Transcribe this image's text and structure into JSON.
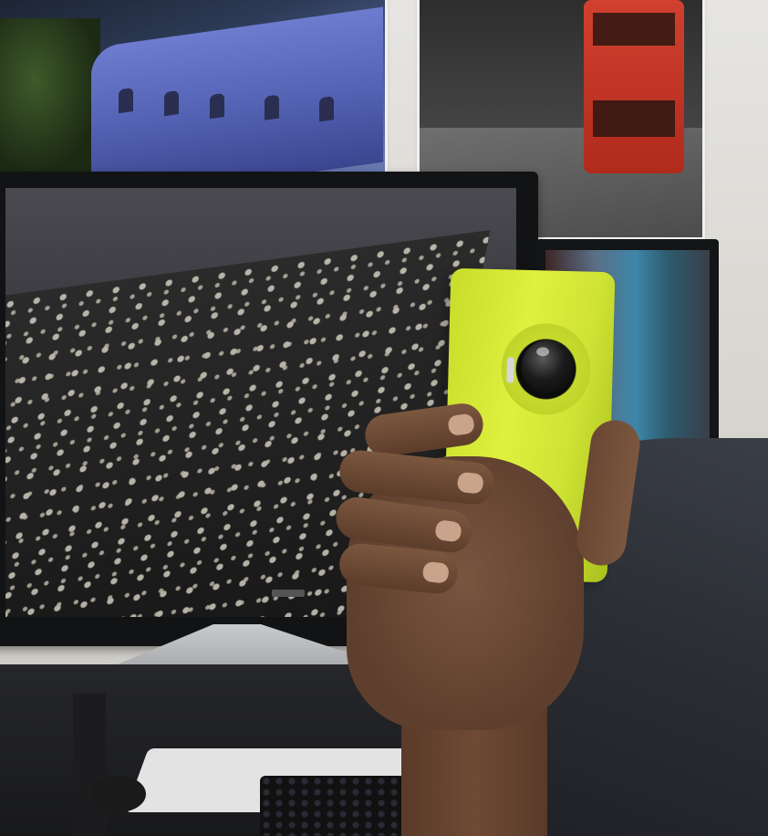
{
  "scene": {
    "colors": {
      "phone": "#d4e838",
      "shirt": "#2a2d33",
      "skin": "#6e4a35",
      "monitor": "#121315",
      "wall": "#e6e5e2"
    }
  }
}
